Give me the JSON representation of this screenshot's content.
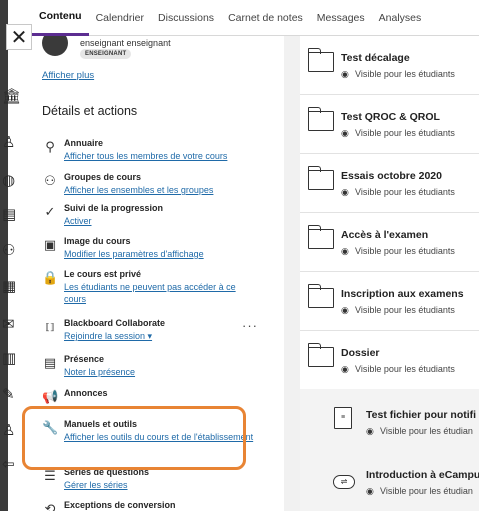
{
  "close": {
    "label": "✕"
  },
  "tabs": [
    {
      "label": "Contenu",
      "active": true
    },
    {
      "label": "Calendrier"
    },
    {
      "label": "Discussions"
    },
    {
      "label": "Carnet de notes"
    },
    {
      "label": "Messages"
    },
    {
      "label": "Analyses"
    }
  ],
  "instructor": {
    "name": "enseignant enseignant",
    "role": "ENSEIGNANT"
  },
  "details": {
    "show_more": "Afficher plus",
    "title": "Détails et actions",
    "items": [
      {
        "icon": "people-icon",
        "title": "Annuaire",
        "link": "Afficher tous les membres de votre cours"
      },
      {
        "icon": "groups-icon",
        "title": "Groupes de cours",
        "link": "Afficher les ensembles et les groupes"
      },
      {
        "icon": "check-circle-icon",
        "title": "Suivi de la progression",
        "link": "Activer"
      },
      {
        "icon": "image-icon",
        "title": "Image du cours",
        "link": "Modifier les paramètres d'affichage"
      },
      {
        "icon": "lock-icon",
        "title": "Le cours est privé",
        "link": "Les étudiants ne peuvent pas accéder à ce cours"
      },
      {
        "icon": "collaborate-icon",
        "title": "Blackboard Collaborate",
        "link": "Rejoindre la session ▾"
      },
      {
        "icon": "attendance-icon",
        "title": "Présence",
        "link": "Noter la présence"
      },
      {
        "icon": "megaphone-icon",
        "title": "Annonces",
        "link": ""
      },
      {
        "icon": "wrench-icon",
        "title": "Manuels et outils",
        "link": "Afficher les outils du cours et de l'établissement"
      },
      {
        "icon": "question-bank-icon",
        "title": "Séries de questions",
        "link": "Gérer les séries"
      },
      {
        "icon": "exceptions-icon",
        "title": "Exceptions de conversion",
        "link": ""
      }
    ],
    "more": "···"
  },
  "content": {
    "folders": [
      {
        "title": "Test décalage",
        "visibility": "Visible pour les étudiants"
      },
      {
        "title": "Test QROC & QROL",
        "visibility": "Visible pour les étudiants"
      },
      {
        "title": "Essais octobre 2020",
        "visibility": "Visible pour les étudiants"
      },
      {
        "title": "Accès à l'examen",
        "visibility": "Visible pour les étudiants"
      },
      {
        "title": "Inscription aux examens",
        "visibility": "Visible pour les étudiants"
      },
      {
        "title": "Dossier",
        "visibility": "Visible pour les étudiants"
      }
    ],
    "nested": [
      {
        "title": "Test fichier pour notifi",
        "visibility": "Visible pour les étudian"
      },
      {
        "title": "Introduction à eCampu",
        "visibility": "Visible pour les étudian"
      }
    ]
  },
  "colors": {
    "accent": "#5c2d91",
    "link": "#1f6aa8",
    "highlight": "#e88434"
  }
}
